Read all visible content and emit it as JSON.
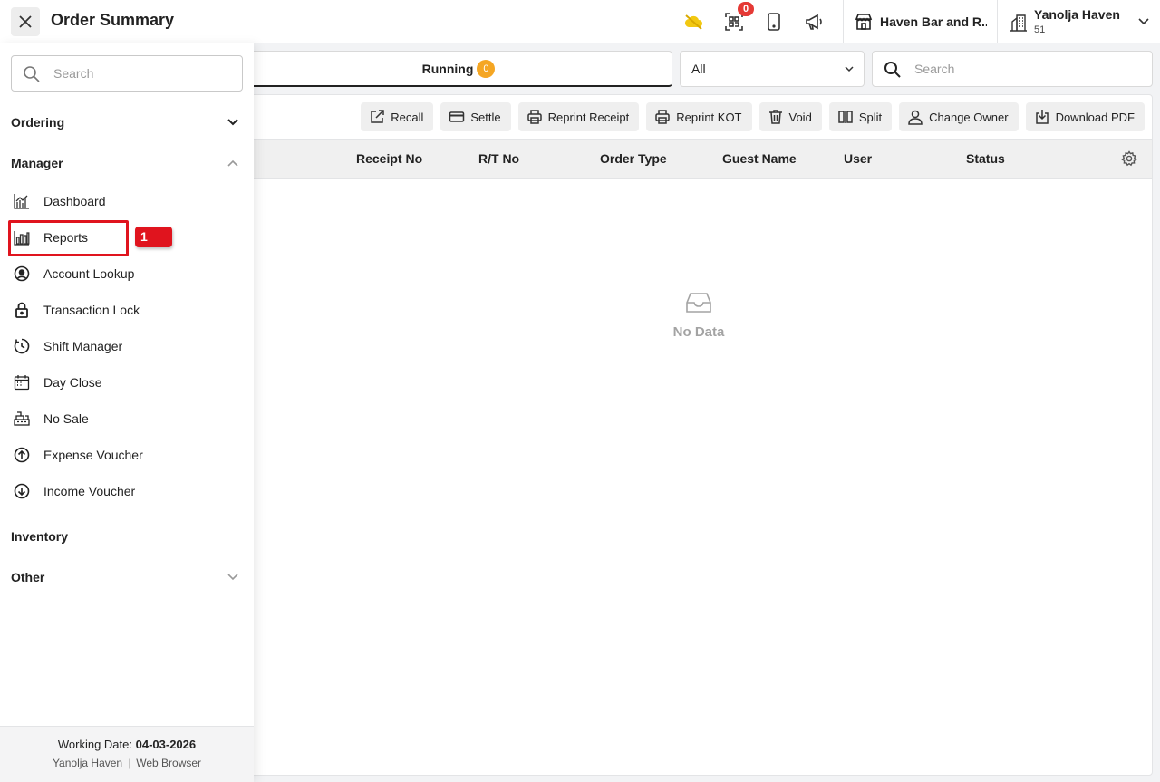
{
  "header": {
    "title": "Order Summary",
    "notification_count": "0",
    "outlet_name": "Haven Bar and R...",
    "user_name": "Yanolja Haven",
    "user_sub": "51",
    "icons": [
      "close-icon",
      "cloud-off-icon",
      "qr-scan-icon",
      "tablet-icon",
      "megaphone-icon",
      "store-icon",
      "building-icon",
      "chevron-down-icon"
    ]
  },
  "main": {
    "tab_label": "Running",
    "tab_count": "0",
    "filter_value": "All",
    "search_placeholder": "Search",
    "actions": [
      "Recall",
      "Settle",
      "Reprint Receipt",
      "Reprint KOT",
      "Void",
      "Split",
      "Change Owner",
      "Download PDF"
    ],
    "columns": [
      "Receipt No",
      "R/T No",
      "Order Type",
      "Guest Name",
      "User",
      "Status"
    ],
    "empty_text": "No Data"
  },
  "sidebar": {
    "search_placeholder": "Search",
    "sections": {
      "ordering": "Ordering",
      "manager": "Manager",
      "inventory": "Inventory",
      "other": "Other"
    },
    "items": [
      "Dashboard",
      "Reports",
      "Account Lookup",
      "Transaction Lock",
      "Shift Manager",
      "Day Close",
      "No Sale",
      "Expense Voucher",
      "Income Voucher"
    ],
    "step_badge": "1",
    "highlight_color": "#e0141e"
  },
  "footer": {
    "working_date_label": "Working Date:",
    "working_date": "04-03-2026",
    "org": "Yanolja Haven",
    "sep": "|",
    "platform": "Web Browser"
  },
  "colors": {
    "accent_badge": "#f5a623",
    "notification": "#e53935",
    "cloud_icon": "#f2c811"
  }
}
